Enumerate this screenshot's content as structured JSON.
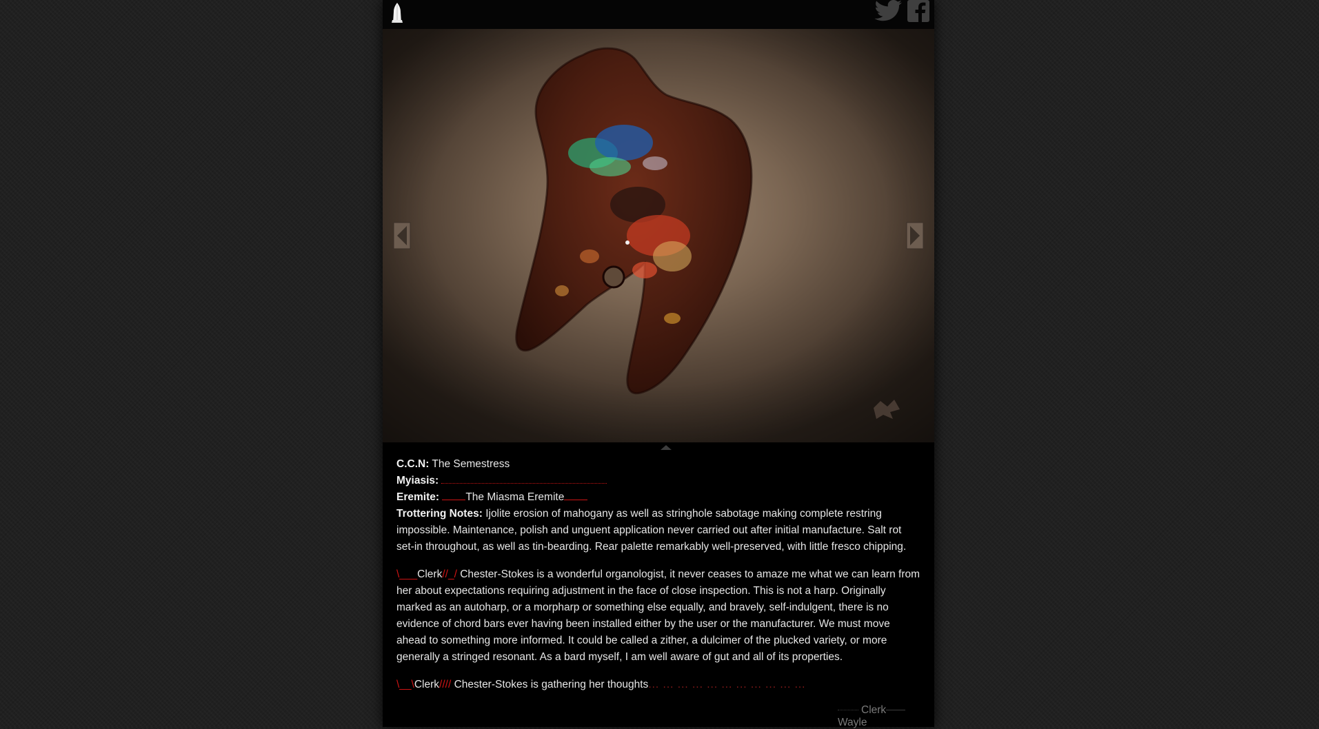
{
  "header": {
    "logo_icon": "quill-pen-icon",
    "social": [
      {
        "icon": "twitter-bird-icon"
      },
      {
        "icon": "facebook-f-icon"
      }
    ]
  },
  "gallery": {
    "image_icon": "painted-wooden-palette-image",
    "prev_icon": "chevron-left-icon",
    "next_icon": "chevron-right-icon",
    "collapse_icon": "caret-up-icon"
  },
  "entry": {
    "ccn_label": "C.C.N:",
    "ccn_value": "The Semestress",
    "myiasis_label": "Myiasis:",
    "eremite_label": "Eremite:",
    "eremite_value": "The Miasma Eremite",
    "notes_label": "Trottering Notes:",
    "notes_text": "Ijolite erosion of mahogany as well as stringhole sabotage making complete restring impossible. Maintenance, polish and unguent application never carried out after initial manufacture. Salt rot set-in throughout, as well as tin-bearding. Rear palette remarkably well-preserved, with little fresco chipping."
  },
  "comments": [
    {
      "prefix": "\\___",
      "name": "Clerk",
      "suffix": "//_/",
      "text": " Chester-Stokes is a wonderful organologist, it never ceases to amaze me what we can learn from her about expectations requiring adjustment in the face of close inspection. This is not a harp. Originally marked as an autoharp, or a morpharp or something else equally, and bravely, self-indulgent, there is no evidence of chord bars ever having been installed either by the user or the manufacturer. We must move ahead to something more informed. It could be called a zither, a dulcimer of the plucked variety, or more generally a stringed resonant. As a bard myself, I am well aware of gut and all of its properties."
    },
    {
      "prefix": "\\__\\",
      "name": "Clerk",
      "suffix": "////",
      "text": " Chester-Stokes is gathering her thoughts",
      "trail": "... ... ... ... ... ... ... ... ... ... ..."
    }
  ],
  "signature": {
    "left": "Clerk",
    "right": "Wayle"
  },
  "colors": {
    "accent": "#d11414",
    "background": "#202020",
    "panel": "#000000"
  }
}
